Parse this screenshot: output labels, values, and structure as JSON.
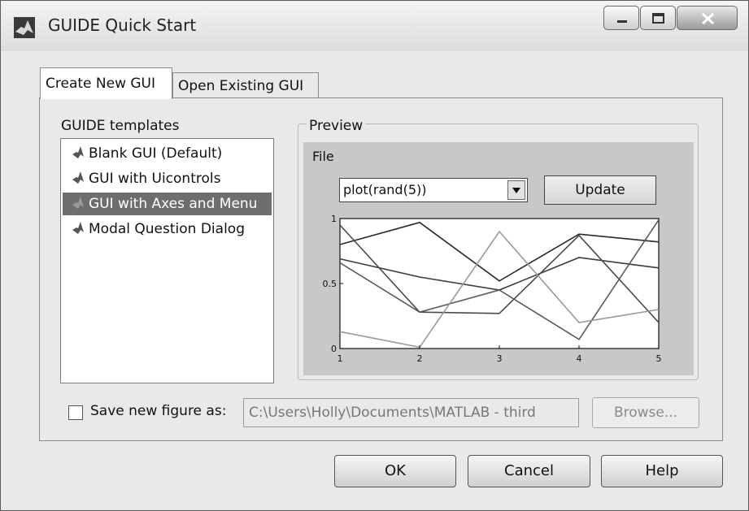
{
  "window": {
    "title": "GUIDE Quick Start",
    "icon": "matlab-icon"
  },
  "tabs": [
    {
      "label": "Create New GUI",
      "active": true
    },
    {
      "label": "Open Existing GUI",
      "active": false
    }
  ],
  "templates": {
    "label": "GUIDE templates",
    "items": [
      {
        "label": "Blank GUI (Default)"
      },
      {
        "label": "GUI with Uicontrols"
      },
      {
        "label": "GUI with Axes and Menu",
        "selected": true
      },
      {
        "label": "Modal Question Dialog"
      }
    ]
  },
  "preview": {
    "label": "Preview",
    "menu": "File",
    "dropdown_value": "plot(rand(5))",
    "update_label": "Update"
  },
  "chart_data": {
    "type": "line",
    "x": [
      1,
      2,
      3,
      4,
      5
    ],
    "xlim": [
      1,
      5
    ],
    "ylim": [
      0,
      1
    ],
    "x_ticks": [
      "1",
      "2",
      "3",
      "4",
      "5"
    ],
    "y_ticks": [
      "0",
      "0.5",
      "1"
    ],
    "series": [
      {
        "values": [
          0.8,
          0.97,
          0.52,
          0.88,
          0.82
        ]
      },
      {
        "values": [
          0.69,
          0.55,
          0.45,
          0.7,
          0.62
        ]
      },
      {
        "values": [
          0.95,
          0.28,
          0.27,
          0.87,
          0.2
        ]
      },
      {
        "values": [
          0.66,
          0.28,
          0.45,
          0.07,
          0.99
        ]
      },
      {
        "values": [
          0.13,
          0.01,
          0.9,
          0.2,
          0.3
        ]
      }
    ],
    "colors": [
      "#2a2a2a",
      "#3c3c3c",
      "#4a4a4a",
      "#5a5a5a",
      "#9a9a9a"
    ]
  },
  "save": {
    "checkbox_label": "Save new figure as:",
    "checked": false,
    "path_value": "C:\\Users\\Holly\\Documents\\MATLAB - third",
    "browse_label": "Browse..."
  },
  "buttons": {
    "ok": "OK",
    "cancel": "Cancel",
    "help": "Help"
  }
}
